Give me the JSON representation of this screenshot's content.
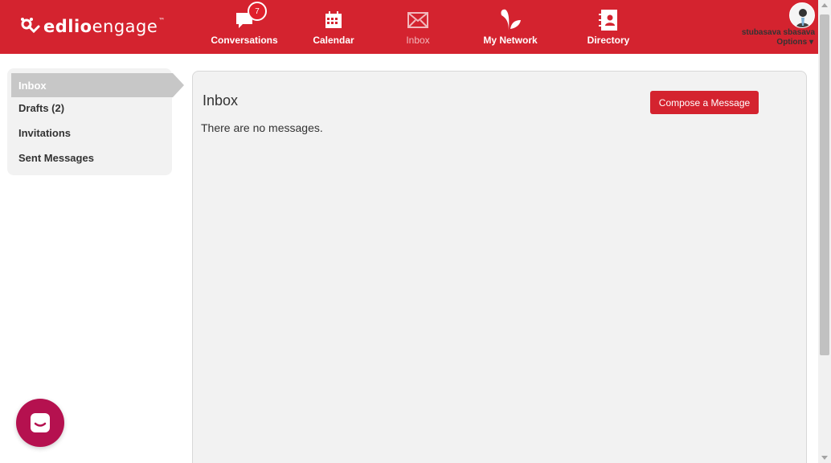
{
  "brand": {
    "name_bold": "edlio",
    "name_light": "engage",
    "tm": "™"
  },
  "nav": [
    {
      "label": "Conversations",
      "icon": "speech-bubble-icon",
      "badge": "7"
    },
    {
      "label": "Calendar",
      "icon": "calendar-icon"
    },
    {
      "label": "Inbox",
      "icon": "envelope-icon",
      "active": true
    },
    {
      "label": "My Network",
      "icon": "sprout-icon"
    },
    {
      "label": "Directory",
      "icon": "contact-book-icon"
    }
  ],
  "user": {
    "name": "stubasava sbasava",
    "options_label": "Options ▾"
  },
  "sidebar": {
    "items": [
      {
        "label": "Inbox",
        "active": true
      },
      {
        "label": "Drafts (2)"
      },
      {
        "label": "Invitations"
      },
      {
        "label": "Sent Messages"
      }
    ]
  },
  "main": {
    "title": "Inbox",
    "compose_label": "Compose a Message",
    "empty_text": "There are no messages."
  },
  "colors": {
    "brand_red": "#d4232f",
    "chat_bubble": "#b5114f",
    "panel_bg": "#f2f2f2",
    "active_item": "#c7c7c7"
  }
}
